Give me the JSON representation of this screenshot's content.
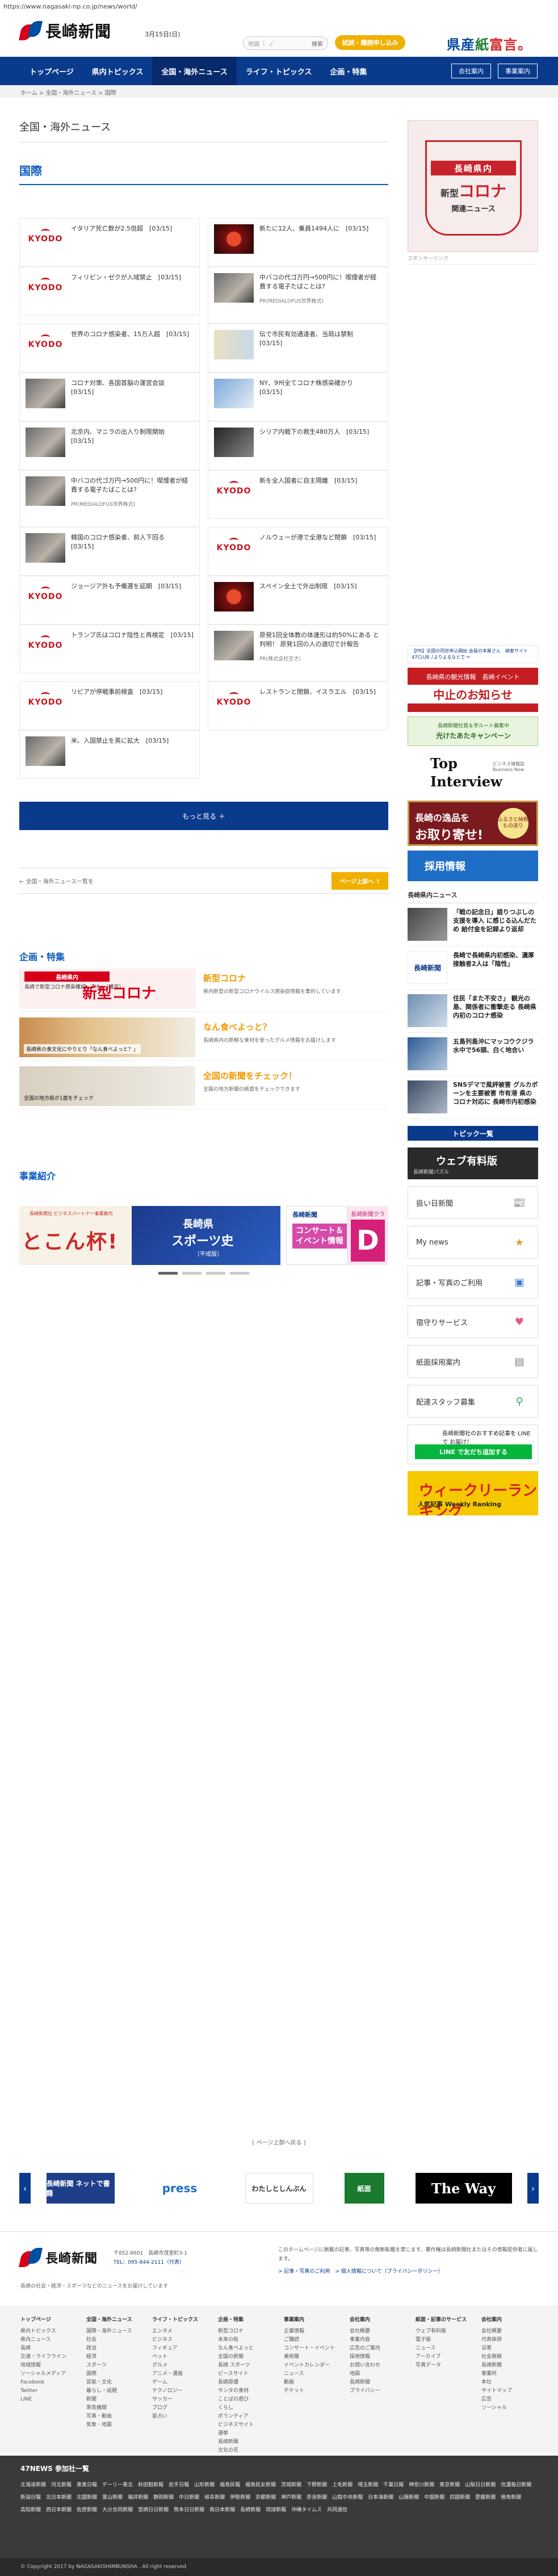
{
  "browser": {
    "url": "https://www.nagasaki-np.co.jp/news/world/"
  },
  "header": {
    "logo_text": "長崎新聞",
    "date": "3月15日(日)",
    "search_placeholder_1": "地図",
    "search_placeholder_2": "ノ",
    "search_go": "検索",
    "trial_button": "試読・購読申し込み",
    "banner": {
      "part1": "県産",
      "part2": "紙",
      "part3": "富言。"
    }
  },
  "nav": {
    "items": [
      "トップページ",
      "県内トピックス",
      "全国・海外ニュース",
      "ライフ・トピックス",
      "企画・特集"
    ],
    "active_index": 2,
    "right_buttons": [
      "会社案内",
      "事業案内"
    ]
  },
  "breadcrumb": "ホーム > 全国・海外ニュース > 国際",
  "main": {
    "section_title": "全国・海外ニュース",
    "sub_title": "国際",
    "cards": [
      {
        "title": "イタリア死亡数が2.5倍超　[03/15]",
        "thumb": "kyodo",
        "credit": ""
      },
      {
        "title": "新たに12人、乗員1494人に　[03/15]",
        "thumb": "red",
        "credit": ""
      },
      {
        "title": "フィリピン・ゼクが入域禁止　[03/15]",
        "thumb": "kyodo",
        "credit": ""
      },
      {
        "title": "中バコの代ゴ万円→500円に！喫煙者が経費する電子たばことは?",
        "thumb": "photo",
        "credit": "PR(MEDIALOFUS世界株式)"
      },
      {
        "title": "世界のコロナ感染者、15万人超　[03/15]",
        "thumb": "kyodo",
        "credit": ""
      },
      {
        "title": "伝で市民有効通達者、当局は禁制　[03/15]",
        "thumb": "map",
        "credit": ""
      },
      {
        "title": "コロナ対策、各国首脳の運営会談　[03/15]",
        "thumb": "photo",
        "credit": ""
      },
      {
        "title": "NY、9州全てコロナ株感染確かり　[03/15]",
        "thumb": "blue",
        "credit": ""
      },
      {
        "title": "北京内、マニラの出入り制限開始　[03/15]",
        "thumb": "photo",
        "credit": ""
      },
      {
        "title": "シリア内戦下の救生480万人　[03/15]",
        "thumb": "dark",
        "credit": ""
      },
      {
        "title": "中バコの代ゴ万円→500円に！喫煙者が経費する電子たばことは?",
        "thumb": "photo",
        "credit": "PR(MEDIALOFUS世界株式)"
      },
      {
        "title": "新を全入国者に自主隔離　[03/15]",
        "thumb": "kyodo",
        "credit": ""
      },
      {
        "title": "韓国のコロナ感染者、前人下回る　[03/15]",
        "thumb": "photo",
        "credit": ""
      },
      {
        "title": "ノルウェーが港で全港など閉鎖　[03/15]",
        "thumb": "kyodo",
        "credit": ""
      },
      {
        "title": "ジョージア外も予備選を延期　[03/15]",
        "thumb": "kyodo",
        "credit": ""
      },
      {
        "title": "スペイン全土で外出制限　[03/15]",
        "thumb": "red",
        "credit": ""
      },
      {
        "title": "トランプ氏はコロナ陰性と再検定　[03/15]",
        "thumb": "kyodo",
        "credit": ""
      },
      {
        "title": "原発1回全体教の体連形は約50%にある と判明！ 原発1回の人の適切で計報告",
        "thumb": "photo",
        "credit": "PR(株式会社空き)"
      },
      {
        "title": "リビアが停戦事前検査　[03/15]",
        "thumb": "kyodo",
        "credit": ""
      },
      {
        "title": "レストランと閉鎖、イスラエル　[03/15]",
        "thumb": "kyodo",
        "credit": ""
      },
      {
        "title": "米、入国禁止を英に拡大　[03/15]",
        "thumb": "photo",
        "credit": ""
      }
    ],
    "more_button": "もっと見る ＋",
    "pager_back": "← 全国・海外ニュース一覧を",
    "pager_top": "ページ上部へ ↑",
    "features_title": "企画・特集",
    "features": [
      {
        "name": "新型コロナ",
        "desc": "県内新型の新型コロナウイルス感染症情報を集約しています",
        "banner_bar": "長崎県内",
        "banner_big": "新型コロナ",
        "banner_caption": "長崎で新型コロナ感染確認、来た。（確定）"
      },
      {
        "name": "なん食べよっと？",
        "desc": "長崎県内の新鮮な食材を使ったグルメ情報をお届けします",
        "banner_caption": "長崎県の食文化にやりとり「なん食べよっと？」"
      },
      {
        "name": "全国の新聞をチェック！",
        "desc": "全国の地方新聞の紙面をチェックできます",
        "banner_caption": "全国の地方紙が1面をチェック"
      }
    ],
    "business_title": "事業紹介",
    "business_panels": {
      "p1_sub": "長崎新聞社 ビジネスパートナー事業案内",
      "p1_big": "とこん杯!",
      "p2_t1": "長崎県",
      "p2_t2": "スポーツ史",
      "p2_t3": "〔平成版〕",
      "p3_t1": "長崎新聞",
      "p3_t2": "コンサート＆イベント情報",
      "p4_t1": "長崎新聞クラブ",
      "p4_t2": "D"
    }
  },
  "sidebar": {
    "covid_banner": {
      "pref": "長崎県内",
      "big_sm": "新型",
      "big": "コロナ",
      "rel": "関連ニュース"
    },
    "sponsor_label": "スポンサーリンク",
    "link_text": "【PR】全国の同窓申込開始 会員の本屋さん　検索サイト 47CLUB ♪よりよるなとで ✏",
    "ads": {
      "stop_t1": "長崎県の観光情報　長崎イベント",
      "stop_t2": "中止のお知らせ",
      "green_t1": "長崎新聞社賞＆学ルート募集中",
      "green_t2": "光けたあたキャンペーン",
      "interview_t1": "Top",
      "interview_t2": "Interview",
      "interview_t3": "ビジネス情報誌 Business Now",
      "gift_t1": "長崎の逸品を",
      "gift_t2": "お取り寄せ!",
      "gift_badge": "ふるさと納税もの送り",
      "recruit": "採用情報"
    },
    "news_head": "長崎県内ニュース",
    "news": [
      {
        "text": "「戦の記念日」語りつぶしの支援を導入 に感じる込んだため 給付金を記録より返却",
        "img": "p1"
      },
      {
        "text": "長崎で長崎県内初感染、濃厚接触者2人は「陰性」",
        "img": "k"
      },
      {
        "text": "住民「また不安さ」 観光の島、関係者に衝撃走る 長崎県内初のコロナ感染",
        "img": "p2"
      },
      {
        "text": "五島列島沖にマッコウクジラ　水中で56頭、白く地合い",
        "img": "p3"
      },
      {
        "text": "SNSデマで風評被害 グルカボーンを主要被害 市有港 県のコロナ対応に 長崎市内初感染",
        "img": "p4"
      }
    ],
    "topics_button": "トピック一覧",
    "jigsaw_t1": "ウェブ有料版",
    "jigsaw_t2": "長崎新聞パズル",
    "menu_boxes": [
      {
        "label": "扱い日新聞",
        "icon": "newspaper-icon"
      },
      {
        "label": "My news",
        "icon": "my-news-icon"
      },
      {
        "label": "記事・写真のご利用",
        "icon": "photo-icon"
      },
      {
        "label": "宿守りサービス",
        "icon": "heart-icon"
      },
      {
        "label": "紙面採用案内",
        "icon": "paper-icon"
      },
      {
        "label": "配達スタッフ募集",
        "icon": "bike-icon"
      }
    ],
    "line_t1": "長崎新聞社のおすすめ記事を LINE で お届け！",
    "line_btn": "LINE で友だち追加する",
    "rank_t1": "ウィークリーランキング",
    "rank_t2": "人気記事 Weekly Ranking"
  },
  "carousel": {
    "title": "[ ページ上部へ戻る ]",
    "items": [
      "長崎新聞 ネットで書籍",
      "press",
      "わたしとしんぶん",
      "紙面",
      "The Way"
    ]
  },
  "footer": {
    "logo_text": "長崎新聞",
    "address": "〒852-8601　長崎市茂里町3-1",
    "tel": "TEL：095-844-2111（代表）",
    "tagline": "長崎の社会・経済・スポーツなどのニュースをお届けしています",
    "note": "このホームページに掲載の記事、写真等の無断転載を禁じます。著作権は長崎新聞社またはその情報提供者に属します。",
    "note_links": "> 記事・写真のご利用　> 個人情報について（プライバシーポリシー）",
    "cols": [
      {
        "h": "トップページ",
        "items": [
          "県内トピックス",
          "県内ニュース",
          "長崎",
          "交通・ライフライン",
          "地域情報",
          "ソーシャルメディア",
          "Facebook",
          "Twitter",
          "LINE"
        ]
      },
      {
        "h": "全国・海外ニュース",
        "items": [
          "国際・海外ニュース",
          "社会",
          "政治",
          "経済",
          "スポーツ",
          "国際",
          "芸能・文化",
          "暮らし・話題",
          "新聞",
          "蒸気機関",
          "写真・動画",
          "気象・地震"
        ]
      },
      {
        "h": "ライフ・トピックス",
        "items": [
          "エンタメ",
          "ビジネス",
          "フィギュア",
          "ペット",
          "グルメ",
          "アニメ・漫画",
          "ゲーム",
          "テクノロジー",
          "サッカー",
          "ブログ",
          "星占い"
        ]
      },
      {
        "h": "企画・特集",
        "items": [
          "新型コロナ",
          "未来の街",
          "なん食べよっと",
          "全国の新聞",
          "長崎 スポーツ",
          "ピースサイト",
          "長崎原爆",
          "サンタの食材",
          "ことばの遊び",
          "くらし",
          "ボランティア",
          "ビジネスサイト",
          "選挙",
          "長崎新聞",
          "文化の花",
          "ペット"
        ]
      },
      {
        "h": "事業案内",
        "items": [
          "企業情報",
          "ご購読",
          "コンサート・イベント",
          "美術展",
          "イベントカレンダー",
          "ニュース",
          "動画",
          "チケット"
        ]
      },
      {
        "h": "会社案内",
        "items": [
          "会社概要",
          "事業内容",
          "広告のご案内",
          "採用情報",
          "お問い合わせ",
          "地図",
          "長崎新聞",
          "プライバシー"
        ]
      },
      {
        "h": "紙面・記事のサービス",
        "items": [
          "ウェブ有料版",
          "電子版",
          "ニュース",
          "アーカイブ",
          "写真データ"
        ]
      },
      {
        "h": "会社案内",
        "items": [
          "会社概要",
          "代表挨拶",
          "沿革",
          "社会貢献",
          "長崎新聞",
          "事業所",
          "本社",
          "サイトマップ",
          "広告",
          "ソーシャル"
        ]
      }
    ],
    "papers_head": "47NEWS 参加社一覧",
    "papers": [
      "北海道新聞",
      "河北新報",
      "東奥日報",
      "デーリー東北",
      "秋田魁新報",
      "岩手日報",
      "山形新聞",
      "福島民報",
      "福島民友新聞",
      "茨城新聞",
      "下野新聞",
      "上毛新聞",
      "埼玉新聞",
      "千葉日報",
      "神奈川新聞",
      "東京新聞",
      "山梨日日新聞",
      "信濃毎日新聞",
      "新潟日報",
      "北日本新聞",
      "北國新聞",
      "富山新聞",
      "福井新聞",
      "静岡新聞",
      "中日新聞",
      "岐阜新聞",
      "伊勢新聞",
      "京都新聞",
      "神戸新聞",
      "奈良新聞",
      "山陰中央新報",
      "日本海新聞",
      "山陽新聞",
      "中国新聞",
      "四国新聞",
      "愛媛新聞",
      "徳島新聞",
      "高知新聞",
      "西日本新聞",
      "佐賀新聞",
      "大分合同新聞",
      "宮崎日日新聞",
      "熊本日日新聞",
      "南日本新聞",
      "長崎新聞",
      "琉球新報",
      "沖縄タイムス",
      "共同通信"
    ],
    "copyright": "© Copyright 2017 by NAGASAKISHIMBUNSHA . All right reserved"
  }
}
